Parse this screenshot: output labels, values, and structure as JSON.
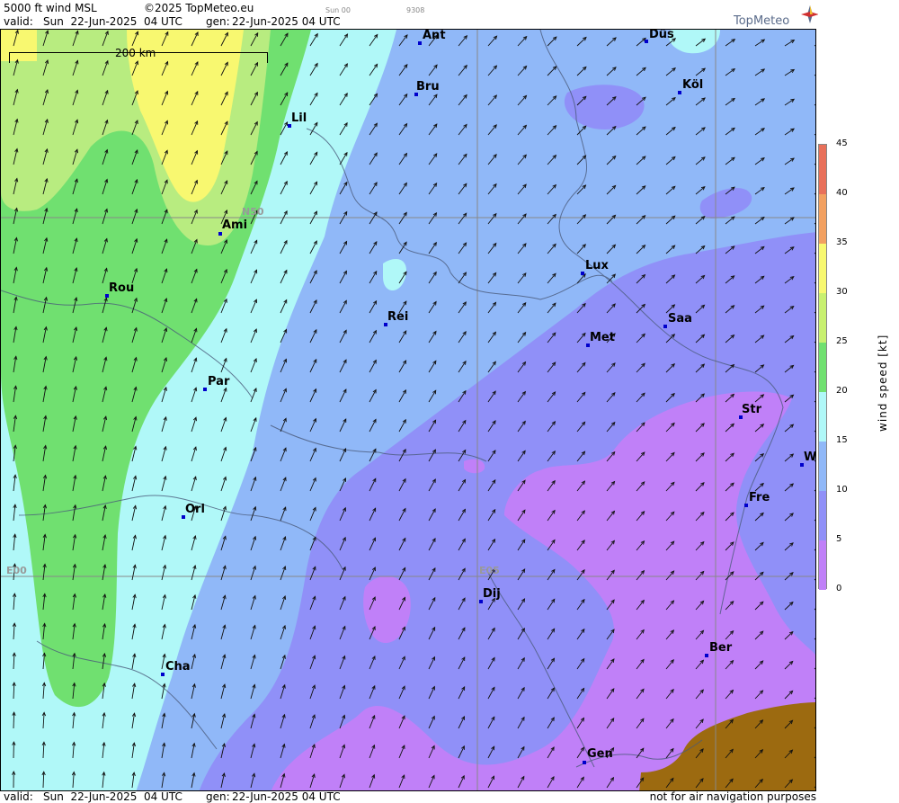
{
  "header": {
    "product": "5000 ft wind MSL",
    "copyright": "©2025 TopMeteo.eu",
    "small_a": "Sun 00",
    "small_b": "9308",
    "valid_label": "valid:",
    "valid_value": "Sun  22-Jun-2025  04 UTC",
    "gen_label": "gen:",
    "gen_value": "22-Jun-2025 04 UTC",
    "logo_text": "TopMeteo"
  },
  "footer": {
    "valid_label": "valid:",
    "valid_value": "Sun  22-Jun-2025  04 UTC",
    "gen_label": "gen:",
    "gen_value": "22-Jun-2025 04 UTC",
    "note": "not for air navigation purposes"
  },
  "scale": {
    "label": "200 km"
  },
  "grid_labels": {
    "lat": "N50",
    "lon_a": "E00",
    "lon_b": "E05"
  },
  "cities": [
    {
      "name": "Ant"
    },
    {
      "name": "Düs"
    },
    {
      "name": "Bru"
    },
    {
      "name": "Köl"
    },
    {
      "name": "Lil"
    },
    {
      "name": "Ami"
    },
    {
      "name": "Rou"
    },
    {
      "name": "Rei"
    },
    {
      "name": "Lux"
    },
    {
      "name": "Met"
    },
    {
      "name": "Saa"
    },
    {
      "name": "Par"
    },
    {
      "name": "Str"
    },
    {
      "name": "W"
    },
    {
      "name": "Fre"
    },
    {
      "name": "Orl"
    },
    {
      "name": "Dij"
    },
    {
      "name": "Ber"
    },
    {
      "name": "Cha"
    },
    {
      "name": "Gen"
    }
  ],
  "legend": {
    "title": "wind speed [kt]",
    "ticks": [
      "45",
      "40",
      "35",
      "30",
      "25",
      "20",
      "15",
      "10",
      "5",
      "0"
    ],
    "colors": [
      "#e8705a",
      "#f2a060",
      "#f4e070",
      "#f8f870",
      "#c8f070",
      "#70e070",
      "#b0f8f8",
      "#90b8f8",
      "#9090f8",
      "#c080f8"
    ]
  },
  "palette": {
    "v0_5": "#c080f8",
    "v5_10": "#9090f8",
    "v10_15": "#90b8f8",
    "v15_20": "#b0f8f8",
    "v20_25": "#70e070",
    "v25_30": "#b8ec80",
    "v30_35": "#f8f870",
    "terrain": "#9c6a10"
  }
}
